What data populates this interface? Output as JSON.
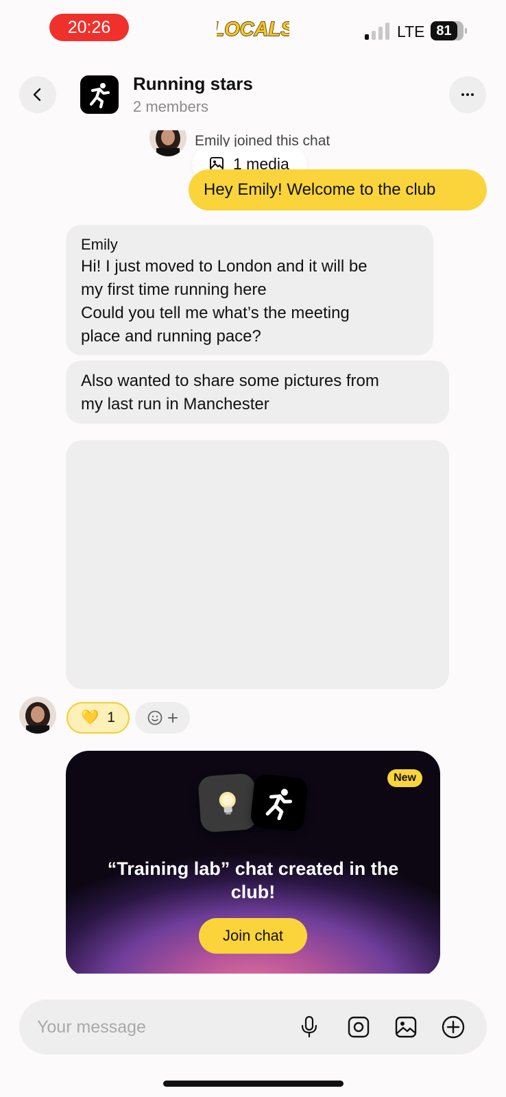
{
  "status_bar": {
    "time": "20:26",
    "network": "LTE",
    "battery": "81",
    "brand_logo_text": "LOCALS",
    "signal_bars_active": 1,
    "signal_bars_total": 4
  },
  "header": {
    "title": "Running stars",
    "subtitle": "2 members",
    "back_icon": "chevron-left-icon",
    "more_icon": "more-dots-icon"
  },
  "system": {
    "joined_text": "Emily joined this chat"
  },
  "media_chip": {
    "label": "1 media",
    "icon": "image-icon"
  },
  "messages": {
    "outgoing_1": "Hey Emily! Welcome to the club",
    "incoming_1": {
      "sender": "Emily",
      "line_1": "Hi! I just moved to London and it will be",
      "line_2": "my first time running here",
      "line_3": "Could you tell me what’s the meeting",
      "line_4": "place and running pace?"
    },
    "incoming_2": {
      "line_1": "Also wanted to share some pictures from",
      "line_2": "my last run in Manchester"
    },
    "reaction": {
      "emoji": "💛",
      "count": "1",
      "add_icon": "smiley-plus-icon"
    }
  },
  "promo": {
    "badge": "New",
    "title": "“Training lab” chat created in the club!",
    "button": "Join chat",
    "icons": [
      "lightbulb-icon",
      "runner-icon"
    ]
  },
  "composer": {
    "placeholder": "Your message",
    "value": "",
    "icons": [
      "microphone-icon",
      "camera-icon",
      "gallery-icon",
      "plus-circle-icon"
    ]
  },
  "colors": {
    "accent_yellow": "#fad43a",
    "bubble_gray": "#efeeef",
    "time_pill_red": "#f0302b",
    "background": "#fcfafb"
  }
}
